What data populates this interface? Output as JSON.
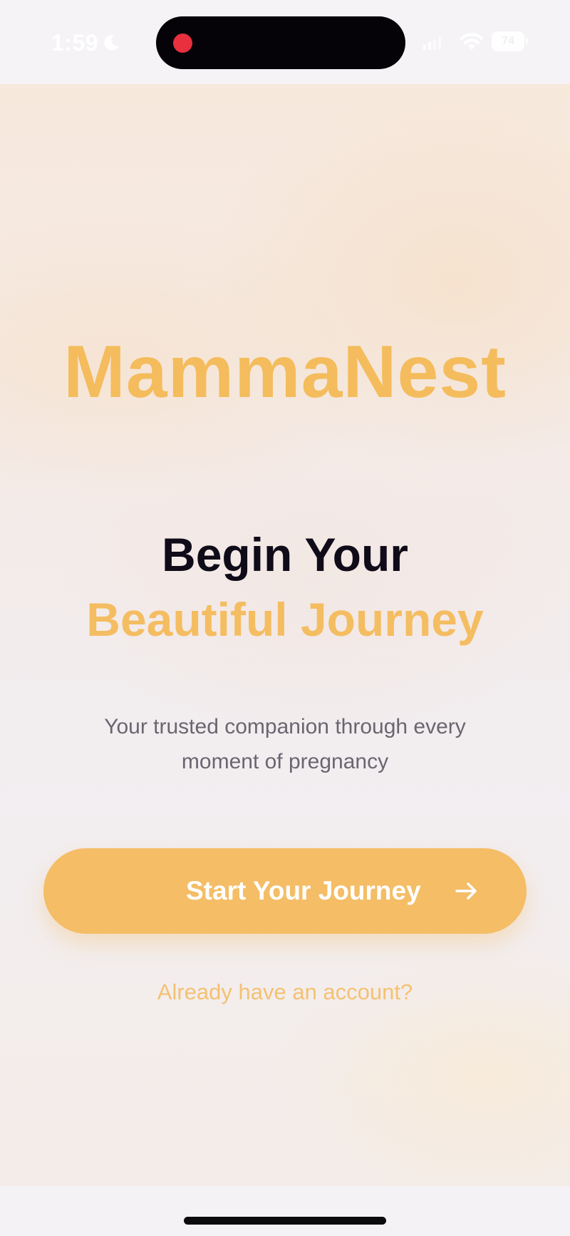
{
  "status_bar": {
    "time": "1:59",
    "focus_icon": "moon-icon",
    "battery_level": "74",
    "recording_indicator_color": "#e8303f"
  },
  "app": {
    "name": "MammaNest",
    "brand_color": "#f4bc5c"
  },
  "hero": {
    "headline_line1": "Begin Your",
    "headline_line2": "Beautiful Journey",
    "tagline": "Your trusted companion through every moment of pregnancy"
  },
  "actions": {
    "primary_label": "Start Your Journey",
    "primary_icon": "arrow-right-icon",
    "secondary_label": "Already have an account?"
  }
}
